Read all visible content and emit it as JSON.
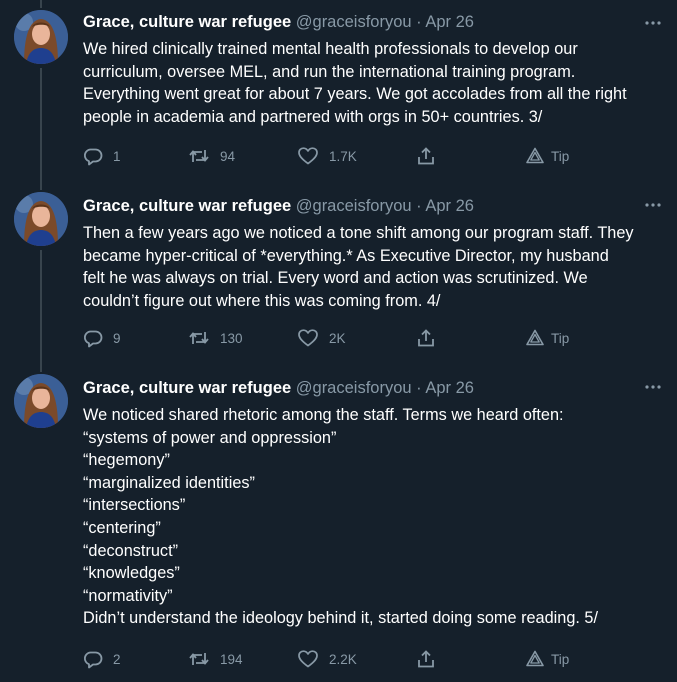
{
  "tweets": [
    {
      "name": "Grace, culture war refugee",
      "handle": "@graceisforyou",
      "separator": "·",
      "date": "Apr 26",
      "lines": [
        "We hired clinically trained mental health professionals to develop our",
        "curriculum, oversee MEL, and run the international training program.",
        "Everything went great for about 7 years. We got accolades from all the right",
        "people in academia and partnered with orgs in 50+ countries. 3/"
      ],
      "replies": "1",
      "retweets": "94",
      "likes": "1.7K",
      "tip_label": "Tip"
    },
    {
      "name": "Grace, culture war refugee",
      "handle": "@graceisforyou",
      "separator": "·",
      "date": "Apr 26",
      "lines": [
        "Then a few years ago we noticed a tone shift among our program staff. They",
        "became hyper-critical of *everything.* As Executive Director, my husband",
        "felt he was always on trial. Every word and action was scrutinized. We",
        "couldn’t figure out where this was coming from. 4/"
      ],
      "replies": "9",
      "retweets": "130",
      "likes": "2K",
      "tip_label": "Tip"
    },
    {
      "name": "Grace, culture war refugee",
      "handle": "@graceisforyou",
      "separator": "·",
      "date": "Apr 26",
      "lines": [
        "We noticed shared rhetoric among the staff. Terms we heard often:",
        "“systems of power and oppression”",
        "“hegemony”",
        "“marginalized identities”",
        "“intersections”",
        "“centering”",
        "“deconstruct”",
        "“knowledges”",
        "“normativity”",
        "Didn’t understand the ideology behind it, started doing some reading. 5/"
      ],
      "replies": "2",
      "retweets": "194",
      "likes": "2.2K",
      "tip_label": "Tip"
    }
  ],
  "colors": {
    "background": "#15202b",
    "text": "#ffffff",
    "secondary": "#8899a6",
    "thread_line": "#38444d"
  },
  "icons": [
    "more-icon",
    "reply-icon",
    "retweet-icon",
    "like-icon",
    "share-icon",
    "tip-icon"
  ]
}
